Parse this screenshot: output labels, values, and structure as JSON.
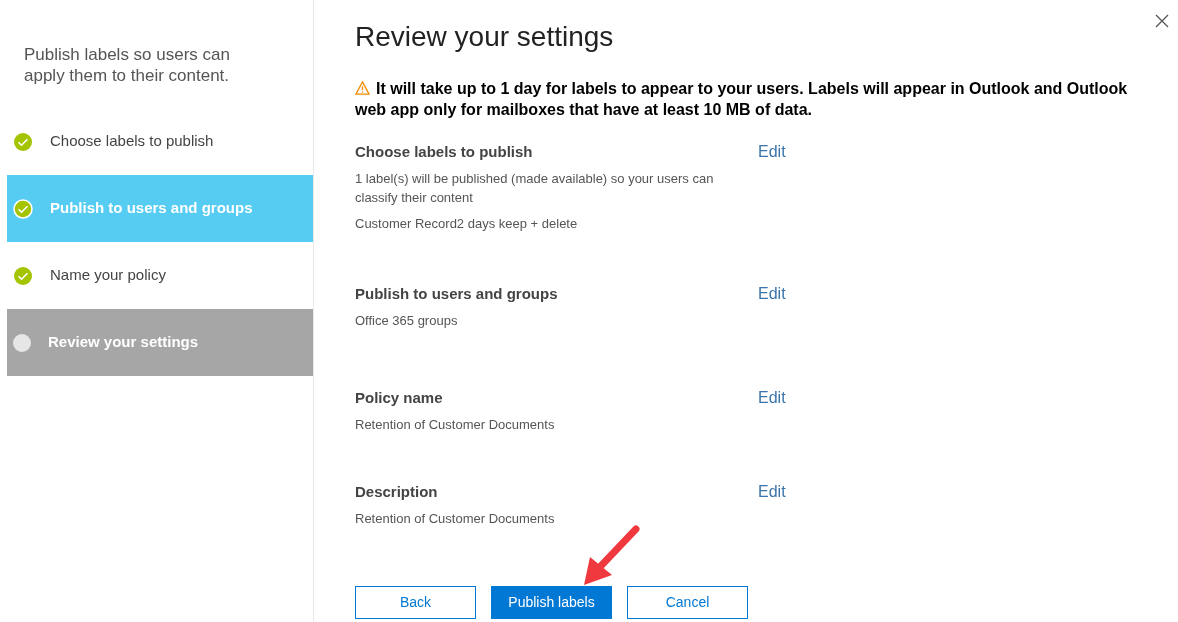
{
  "sidebar": {
    "intro": "Publish labels so users can apply them to their content.",
    "steps": [
      {
        "label": "Choose labels to publish",
        "done": true,
        "selected": false
      },
      {
        "label": "Publish to users and groups",
        "done": true,
        "selected": true
      },
      {
        "label": "Name your policy",
        "done": true,
        "selected": false
      },
      {
        "label": "Review your settings",
        "done": false,
        "selected": false
      }
    ]
  },
  "main": {
    "title": "Review your settings",
    "warning": "It will take up to 1 day for labels to appear to your users. Labels will appear in Outlook and Outlook web app only for mailboxes that have at least 10 MB of data.",
    "sections": [
      {
        "title": "Choose labels to publish",
        "edit": "Edit",
        "lines": [
          "1 label(s) will be published (made available) so your users can classify their content",
          "Customer Record2 days keep + delete"
        ]
      },
      {
        "title": "Publish to users and groups",
        "edit": "Edit",
        "lines": [
          "Office 365 groups"
        ]
      },
      {
        "title": "Policy name",
        "edit": "Edit",
        "lines": [
          "Retention of Customer Documents"
        ]
      },
      {
        "title": "Description",
        "edit": "Edit",
        "lines": [
          "Retention of Customer Documents"
        ]
      }
    ],
    "buttons": [
      {
        "label": "Back",
        "kind": "secondary"
      },
      {
        "label": "Publish labels",
        "kind": "primary"
      },
      {
        "label": "Cancel",
        "kind": "secondary"
      }
    ]
  }
}
